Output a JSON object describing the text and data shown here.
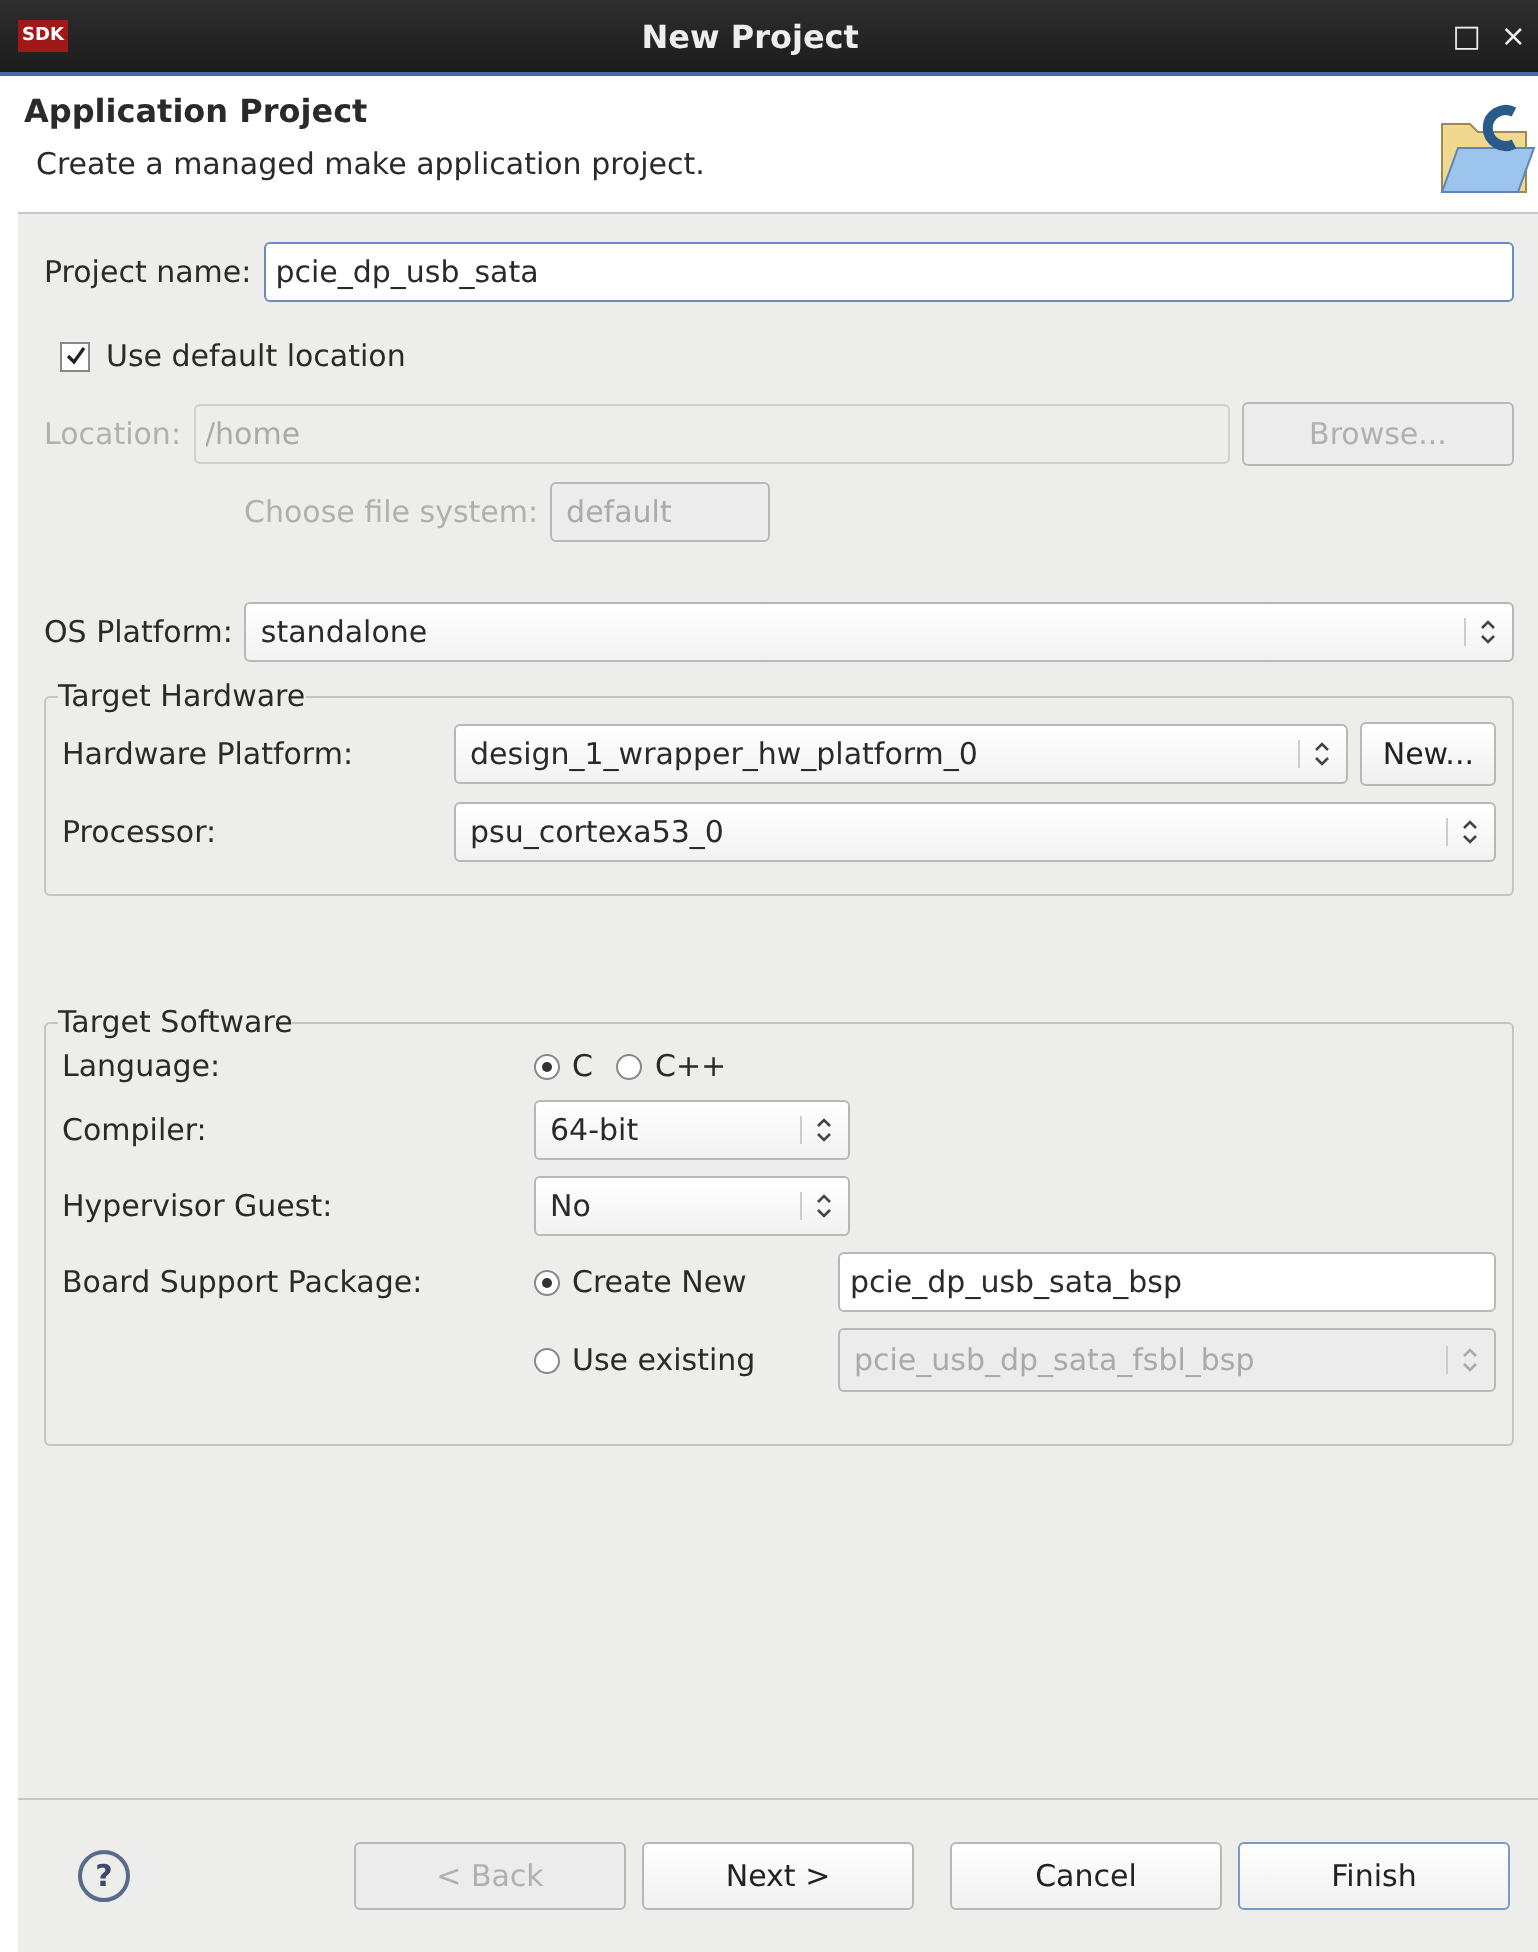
{
  "window": {
    "title": "New Project",
    "logo": "SDK",
    "maximize": "□",
    "close": "×"
  },
  "header": {
    "title": "Application Project",
    "description": "Create a managed make application project."
  },
  "project_name": {
    "label": "Project name:",
    "value": "pcie_dp_usb_sata"
  },
  "use_default_location": {
    "label": "Use default location",
    "checked": true
  },
  "location": {
    "label": "Location:",
    "value": "/home",
    "disabled": true,
    "button": "Browse..."
  },
  "file_system": {
    "label": "Choose file system:",
    "value": "default",
    "disabled": true
  },
  "os_platform": {
    "label": "OS Platform:",
    "value": "standalone"
  },
  "target_hardware": {
    "title": "Target Hardware",
    "hardware_platform": {
      "label": "Hardware Platform:",
      "value": "design_1_wrapper_hw_platform_0",
      "button": "New..."
    },
    "processor": {
      "label": "Processor:",
      "value": "psu_cortexa53_0"
    }
  },
  "target_software": {
    "title": "Target Software",
    "language": {
      "label": "Language:",
      "options": [
        {
          "label": "C",
          "selected": true
        },
        {
          "label": "C++",
          "selected": false
        }
      ]
    },
    "compiler": {
      "label": "Compiler:",
      "value": "64-bit"
    },
    "hypervisor_guest": {
      "label": "Hypervisor Guest:",
      "value": "No"
    },
    "bsp": {
      "label": "Board Support Package:",
      "options": [
        {
          "label": "Create New",
          "selected": true,
          "kind": "text",
          "value": "pcie_dp_usb_sata_bsp",
          "disabled": false
        },
        {
          "label": "Use existing",
          "selected": false,
          "kind": "dropdown",
          "value": "pcie_usb_dp_sata_fsbl_bsp",
          "disabled": true
        }
      ]
    }
  },
  "buttons": [
    {
      "label": "< Back",
      "disabled": true,
      "default": false
    },
    {
      "label": "Next >",
      "disabled": false,
      "default": false
    },
    {
      "label": "Cancel",
      "disabled": false,
      "default": false
    },
    {
      "label": "Finish",
      "disabled": false,
      "default": true
    }
  ],
  "help": "?"
}
